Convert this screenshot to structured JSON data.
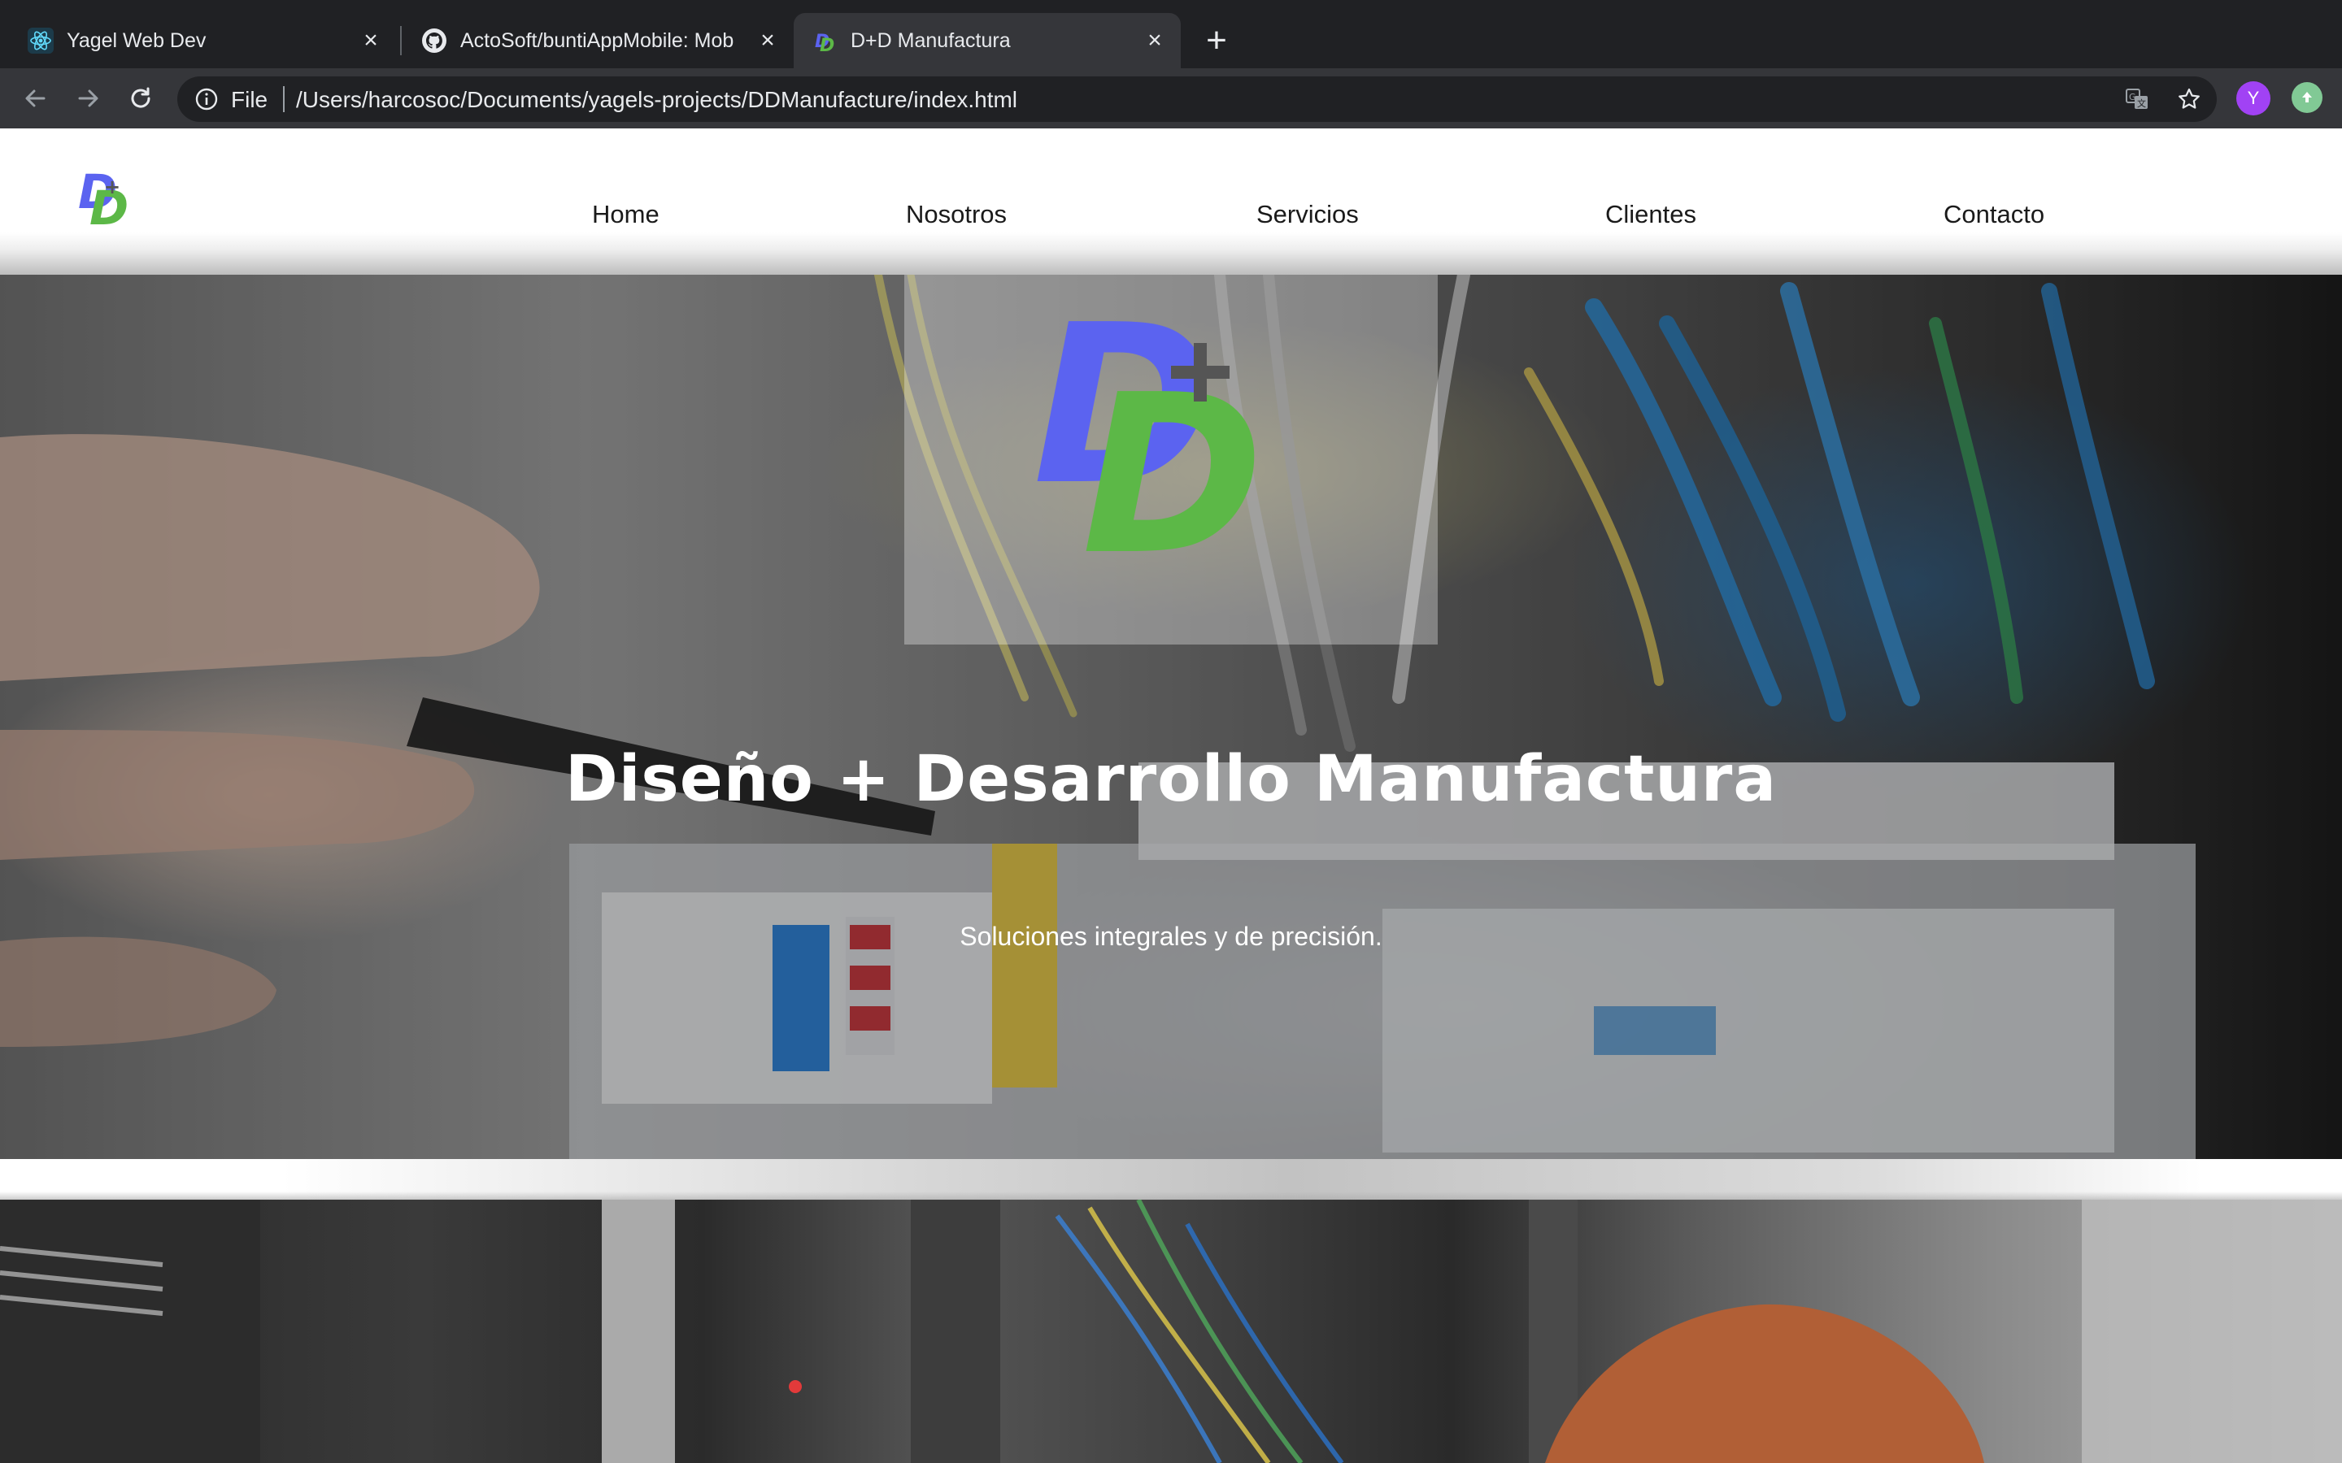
{
  "browser": {
    "tabs": [
      {
        "title": "Yagel Web Dev",
        "icon": "react-icon",
        "active": false
      },
      {
        "title": "ActoSoft/buntiAppMobile: Mob",
        "icon": "github-icon",
        "active": false
      },
      {
        "title": "D+D Manufactura",
        "icon": "dd-logo-icon",
        "active": true
      }
    ],
    "address": {
      "scheme": "File",
      "url": "/Users/harcosoc/Documents/yagels-projects/DDManufacture/index.html"
    },
    "profile_initial": "Y"
  },
  "site": {
    "nav": [
      "Home",
      "Nosotros",
      "Servicios",
      "Clientes",
      "Contacto"
    ],
    "hero": {
      "title": "Diseño + Desarrollo Manufactura",
      "subtitle": "Soluciones integrales y de precisión."
    },
    "colors": {
      "logo_blue": "#5b63f0",
      "logo_green": "#5cb847",
      "logo_plus": "#555555"
    }
  }
}
